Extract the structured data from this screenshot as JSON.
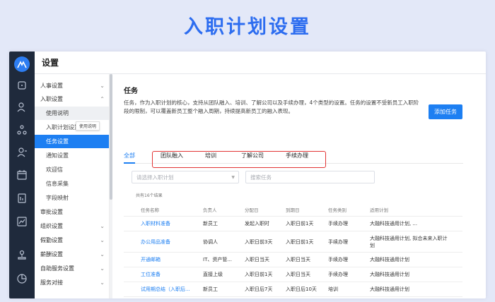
{
  "banner": {
    "title": "入职计划设置"
  },
  "topbar": {
    "title": "设置"
  },
  "rail": {
    "icons": [
      "home-icon",
      "user-icon",
      "org-icon",
      "person-icon",
      "calendar-icon",
      "report-icon",
      "chart-icon",
      "stamp-icon",
      "pie-icon"
    ]
  },
  "sidebar": {
    "items": [
      {
        "label": "人事设置",
        "level": "group",
        "chevron": "⌄"
      },
      {
        "label": "入职设置",
        "level": "group",
        "chevron": "⌃"
      },
      {
        "label": "使用说明",
        "level": "sub"
      },
      {
        "label": "入职计划设置",
        "level": "sub"
      },
      {
        "label": "任务设置",
        "level": "sub",
        "active": true
      },
      {
        "label": "通知设置",
        "level": "sub"
      },
      {
        "label": "欢迎信",
        "level": "sub"
      },
      {
        "label": "信息采集",
        "level": "sub"
      },
      {
        "label": "字段映射",
        "level": "sub"
      },
      {
        "label": "审批设置",
        "level": "group"
      },
      {
        "label": "组织设置",
        "level": "group",
        "chevron": "⌄"
      },
      {
        "label": "假勤设置",
        "level": "group",
        "chevron": "⌄"
      },
      {
        "label": "薪酬设置",
        "level": "group",
        "chevron": "⌄"
      },
      {
        "label": "自助服务设置",
        "level": "group",
        "chevron": "⌄"
      },
      {
        "label": "服务对接",
        "level": "group",
        "chevron": "⌄"
      }
    ],
    "tooltip": "使用说明"
  },
  "content": {
    "title": "任务",
    "description": "任务，作为入职计划的核心，支持从团队融入、培训、了解公司以及手续办理，4个类型的设置。任务的设置不受新员工入职阶段的限制，可以覆盖新员工整个融入周期，持续提高新员工的融入表现。",
    "add_button": "添加任务",
    "tabs": [
      "全部",
      "团队融入",
      "培训",
      "了解公司",
      "手续办理"
    ],
    "filter_plan_placeholder": "请选择入职计划",
    "search_placeholder": "搜索任务",
    "count_text": "共有16个结果"
  },
  "table": {
    "headers": [
      "任务名称",
      "负责人",
      "分配日",
      "到期日",
      "任务类别",
      "适用计划"
    ],
    "rows": [
      [
        "入职材料准备",
        "新员工",
        "发起入职时",
        "入职日前1天",
        "手续办理",
        "大融科技通用计划, ..."
      ],
      [
        "办公用品准备",
        "协调人",
        "入职日前3天",
        "入职日前1天",
        "手续办理",
        "大融科技通用计划, 拟合未来入职计划"
      ],
      [
        "开通邮箱",
        "IT、资产管...",
        "入职日当天",
        "入职日当天",
        "手续办理",
        "大融科技通用计划"
      ],
      [
        "工位准备",
        "直接上级",
        "入职日前1天",
        "入职日当天",
        "手续办理",
        "大融科技通用计划"
      ],
      [
        "试用期总结（入职后...",
        "新员工",
        "入职日后7天",
        "入职日后10天",
        "培训",
        "大融科技通用计划"
      ]
    ]
  },
  "colors": {
    "accent": "#1d7ff2",
    "highlight": "#e23434",
    "rail": "#1f2a3c",
    "banner_text": "#2d6df0"
  }
}
